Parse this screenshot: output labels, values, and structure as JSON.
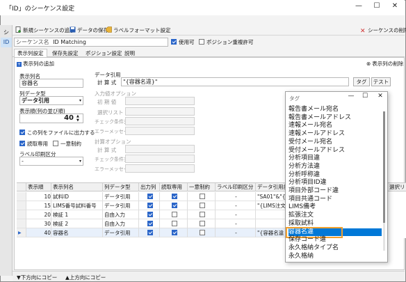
{
  "window": {
    "title": "「ID」のシーケンス設定",
    "min": "—",
    "max": "☐",
    "close": "✕"
  },
  "left_tabs": [
    "シ",
    "ID"
  ],
  "toolbar": {
    "add_sequence": "新規シーケンスの追加",
    "save_data": "データの保存",
    "label_format": "ラベルフォーマット設定",
    "delete_sequence": "シーケンスの削除"
  },
  "sequence": {
    "label": "シーケンス名",
    "value": "ID Matching",
    "enabled_label": "使用可",
    "position_dup_label": "ポジション重複許可"
  },
  "tabs": [
    "表示列設定",
    "保存先設定",
    "ポジション設定",
    "説明"
  ],
  "column": {
    "add_label": "表示列の追加",
    "delete_label": "表示列の削除",
    "name_label": "表示列名",
    "name_value": "容器名",
    "type_label": "列データ型",
    "type_value": "データ引用",
    "order_label": "表示順(列の並び順)",
    "order_value": "40",
    "output_file": "この列をファイルに出力する",
    "readonly": "読取専用",
    "unique": "一意制約",
    "print_label": "ラベル印刷区分",
    "print_value": "-"
  },
  "citation": {
    "title": "データ引用",
    "formula_label": "計 算 式",
    "formula_value": "\"{容器名違}\"",
    "tag_button": "タグ",
    "test_button": "テスト"
  },
  "input_option": {
    "title": "入力値オプション",
    "initial": "初 期 値",
    "select_list": "選択リスト",
    "check_cond": "チェック条件式",
    "error_msg": "エラーメッセージ"
  },
  "calc_option": {
    "title": "計算オプション",
    "formula": "計 算 式",
    "check_cond": "チェック条件式",
    "error_msg": "エラーメッセージ"
  },
  "grid": {
    "headers": [
      "表示順",
      "表示列名",
      "列データ型",
      "出力列",
      "読取専用",
      "一意制約",
      "ラベル印刷区分",
      "データ引用計"
    ],
    "rows": [
      {
        "order": "10",
        "name": "試料ID",
        "type": "データ引用",
        "out": true,
        "ro": true,
        "uniq": false,
        "print": "-",
        "formula": "\"SA01\"&\"{"
      },
      {
        "order": "15",
        "name": "LIMS番号試料番号",
        "type": "データ引用",
        "out": true,
        "ro": true,
        "uniq": false,
        "print": "-",
        "formula": "\"{LIMS注文"
      },
      {
        "order": "20",
        "name": "検証 1",
        "type": "自由入力",
        "out": true,
        "ro": false,
        "uniq": false,
        "print": "-",
        "formula": ""
      },
      {
        "order": "30",
        "name": "検証 2",
        "type": "自由入力",
        "out": true,
        "ro": false,
        "uniq": false,
        "print": "-",
        "formula": ""
      },
      {
        "order": "40",
        "name": "容器名",
        "type": "データ引用",
        "out": true,
        "ro": true,
        "uniq": false,
        "print": "-",
        "formula": "\"{容器名違"
      }
    ],
    "extra_col": "選択リ"
  },
  "bottom": {
    "copy_down": "下方向にコピー",
    "copy_up": "上方向にコピー"
  },
  "tag_popup": {
    "title": "タグ",
    "items": [
      "報告書メール宛名",
      "報告書メールアドレス",
      "速報メール宛名",
      "速報メールアドレス",
      "受付メール宛名",
      "受付メールアドレス",
      "分析項目違",
      "分析方法違",
      "分析呼称違",
      "分析項目ID違",
      "項目外部コード違",
      "項目共通コード",
      "LIMS備考",
      "拡張注文",
      "採取試料",
      "容器名違",
      "保存コード違",
      "永久格納タイプ名",
      "永久格納"
    ],
    "selected_index": 15
  },
  "colors": {
    "accent": "#0078d7",
    "highlight": "#f0a030",
    "check": "#2b66c9"
  }
}
